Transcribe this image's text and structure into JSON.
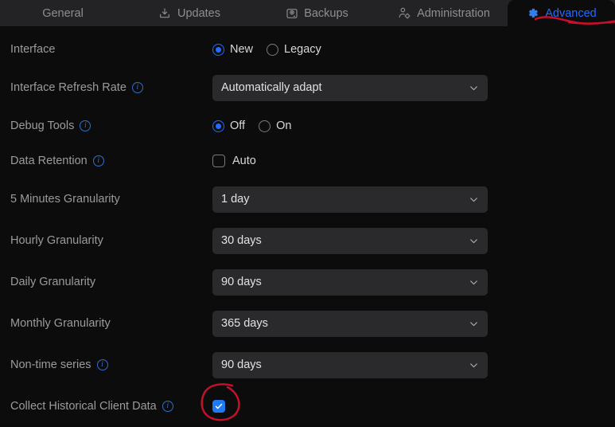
{
  "tabs": [
    {
      "id": "general",
      "label": "General",
      "icon": "none",
      "active": false
    },
    {
      "id": "updates",
      "label": "Updates",
      "icon": "download-icon",
      "active": false
    },
    {
      "id": "backups",
      "label": "Backups",
      "icon": "disk-icon",
      "active": false
    },
    {
      "id": "administration",
      "label": "Administration",
      "icon": "user-gear-icon",
      "active": false
    },
    {
      "id": "advanced",
      "label": "Advanced",
      "icon": "gear-icon",
      "active": true
    }
  ],
  "colors": {
    "accent_blue": "#1f6dff",
    "checkbox_blue": "#1f7bf5",
    "info_blue": "#2f6fd0",
    "annotation_red": "#c8102a",
    "tabbar_bg": "#232326",
    "page_bg": "#0c0c0d",
    "select_bg": "#2a2a2d",
    "label_grey": "#9b9b9e"
  },
  "form": {
    "interface": {
      "label": "Interface",
      "has_info": false,
      "options": [
        {
          "label": "New",
          "selected": true
        },
        {
          "label": "Legacy",
          "selected": false
        }
      ]
    },
    "interface_refresh_rate": {
      "label": "Interface Refresh Rate",
      "has_info": true,
      "value": "Automatically adapt"
    },
    "debug_tools": {
      "label": "Debug Tools",
      "has_info": true,
      "options": [
        {
          "label": "Off",
          "selected": true
        },
        {
          "label": "On",
          "selected": false
        }
      ]
    },
    "data_retention": {
      "label": "Data Retention",
      "has_info": true,
      "checkbox_label": "Auto",
      "checked": false
    },
    "five_minutes_granularity": {
      "label": "5 Minutes Granularity",
      "has_info": false,
      "value": "1 day"
    },
    "hourly_granularity": {
      "label": "Hourly Granularity",
      "has_info": false,
      "value": "30 days"
    },
    "daily_granularity": {
      "label": "Daily Granularity",
      "has_info": false,
      "value": "90 days"
    },
    "monthly_granularity": {
      "label": "Monthly Granularity",
      "has_info": false,
      "value": "365 days"
    },
    "non_time_series": {
      "label": "Non-time series",
      "has_info": true,
      "value": "90 days"
    },
    "collect_historical_client_data": {
      "label": "Collect Historical Client Data",
      "has_info": true,
      "checked": true
    }
  },
  "annotations": [
    {
      "id": "advanced-tab-underline",
      "shape": "underline",
      "color": "#c8102a"
    },
    {
      "id": "collect-historical-checkbox-circle",
      "shape": "circle",
      "color": "#c8102a"
    }
  ],
  "info_glyph": "i"
}
